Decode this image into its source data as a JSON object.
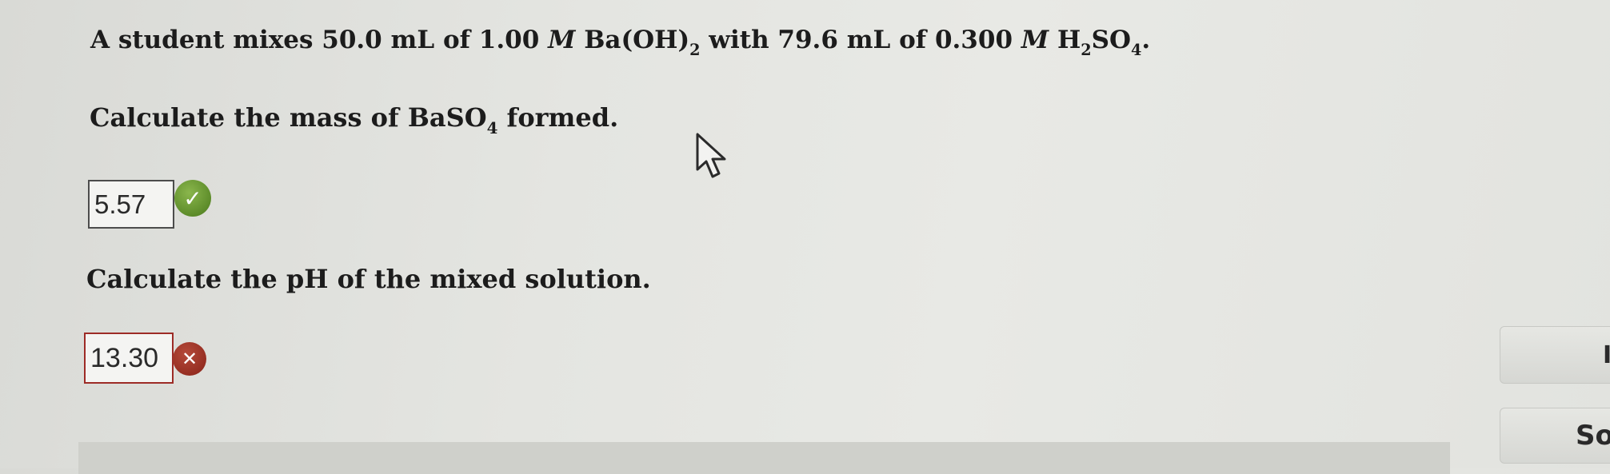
{
  "problem": {
    "intro": "A student mixes",
    "volume_base": "50.0 mL",
    "of_1": "of",
    "conc_base": "1.00",
    "molar_symbol_1": "M",
    "base_formula": "Ba(OH)",
    "base_subscript": "2",
    "with": "with",
    "volume_acid": "79.6 mL",
    "of_2": "of",
    "conc_acid": "0.300",
    "molar_symbol_2": "M",
    "acid_formula_h": "H",
    "acid_subscript_h": "2",
    "acid_formula_so": "SO",
    "acid_subscript_o": "4",
    "end_punct": "."
  },
  "question_mass": {
    "prefix": "Calculate the mass of",
    "formula": "BaSO",
    "subscript": "4",
    "suffix": "formed."
  },
  "answer_mass": {
    "value": "5.57",
    "status": "correct",
    "status_color": "#5d8c2a",
    "status_icon": "check-icon",
    "status_glyph": "✓"
  },
  "question_ph": {
    "text": "Calculate the pH of the mixed solution."
  },
  "answer_ph": {
    "value": "13.30",
    "status": "incorrect",
    "status_color": "#962e22",
    "status_icon": "x-icon",
    "status_glyph": "✕"
  },
  "side_buttons": {
    "button_1_label": "I",
    "button_2_label": "So"
  },
  "cursor_icon": "arrow-cursor-icon"
}
